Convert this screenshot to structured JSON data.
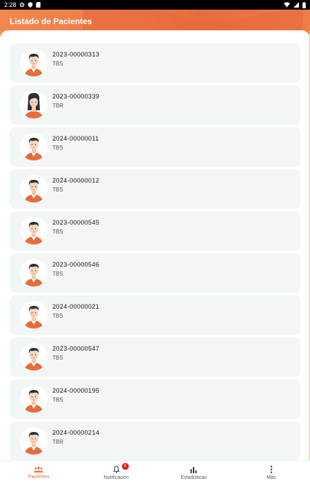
{
  "status_bar": {
    "time": "2:28",
    "icons": [
      "settings-icon",
      "shield-icon",
      "sim-card-icon",
      "wifi-icon",
      "signal-icon",
      "battery-icon"
    ]
  },
  "header": {
    "title": "Listado de Pacientes"
  },
  "patients": [
    {
      "code": "2023-00000313",
      "type": "TBS",
      "avatar": "male-avatar-icon"
    },
    {
      "code": "2023-00000339",
      "type": "TBR",
      "avatar": "female-avatar-icon"
    },
    {
      "code": "2024-00000011",
      "type": "TBS",
      "avatar": "male-avatar-icon"
    },
    {
      "code": "2024-00000012",
      "type": "TBS",
      "avatar": "male-avatar-icon"
    },
    {
      "code": "2023-00000545",
      "type": "TBS",
      "avatar": "male-avatar-icon"
    },
    {
      "code": "2023-00000546",
      "type": "TBS",
      "avatar": "male-avatar-icon"
    },
    {
      "code": "2024-00000021",
      "type": "TBS",
      "avatar": "male-avatar-icon"
    },
    {
      "code": "2023-00000547",
      "type": "TBS",
      "avatar": "male-avatar-icon"
    },
    {
      "code": "2024-00000195",
      "type": "TBS",
      "avatar": "male-avatar-icon"
    },
    {
      "code": "2024-00000214",
      "type": "TBR",
      "avatar": "male-avatar-icon"
    }
  ],
  "bottom_nav": {
    "items": [
      {
        "label": "Pacientes",
        "icon": "people-icon",
        "active": true
      },
      {
        "label": "Notificación",
        "icon": "bell-icon",
        "badge": "9"
      },
      {
        "label": "Estadísticas",
        "icon": "bar-chart-icon"
      },
      {
        "label": "Más",
        "icon": "more-vertical-icon"
      }
    ]
  },
  "colors": {
    "accent": "#E86C3B",
    "card_bg": "#F2F6F5",
    "badge": "#E02020"
  }
}
